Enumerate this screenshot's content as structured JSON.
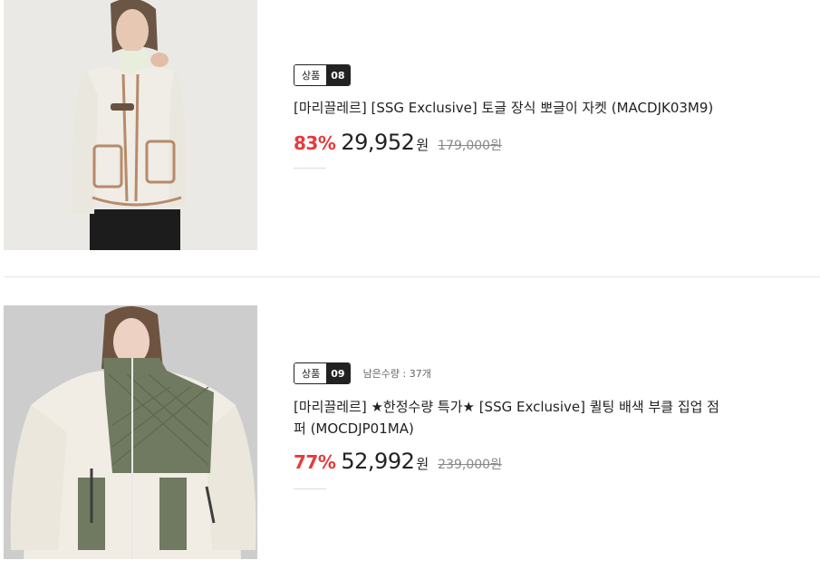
{
  "products": [
    {
      "badge_label": "상품",
      "badge_number": "08",
      "stock_text": "",
      "title": "[마리끌레르] [SSG Exclusive] 토글 장식 뽀글이 자켓 (MACDJK03M9)",
      "discount": "83%",
      "price": "29,952",
      "currency": "원",
      "original_price": "179,000원",
      "image_desc": "cream-fleece-jacket-photo"
    },
    {
      "badge_label": "상품",
      "badge_number": "09",
      "stock_text": "남은수량 : 37개",
      "title": "[마리끌레르] ★한정수량 특가★ [SSG Exclusive] 퀼팅 배색 부클 집업 점퍼 (MOCDJP01MA)",
      "discount": "77%",
      "price": "52,992",
      "currency": "원",
      "original_price": "239,000원",
      "image_desc": "quilted-boucle-zip-jumper-photo"
    }
  ],
  "colors": {
    "discount": "#e8393c",
    "badge_dark": "#222222",
    "divider": "#e4e4e4"
  }
}
